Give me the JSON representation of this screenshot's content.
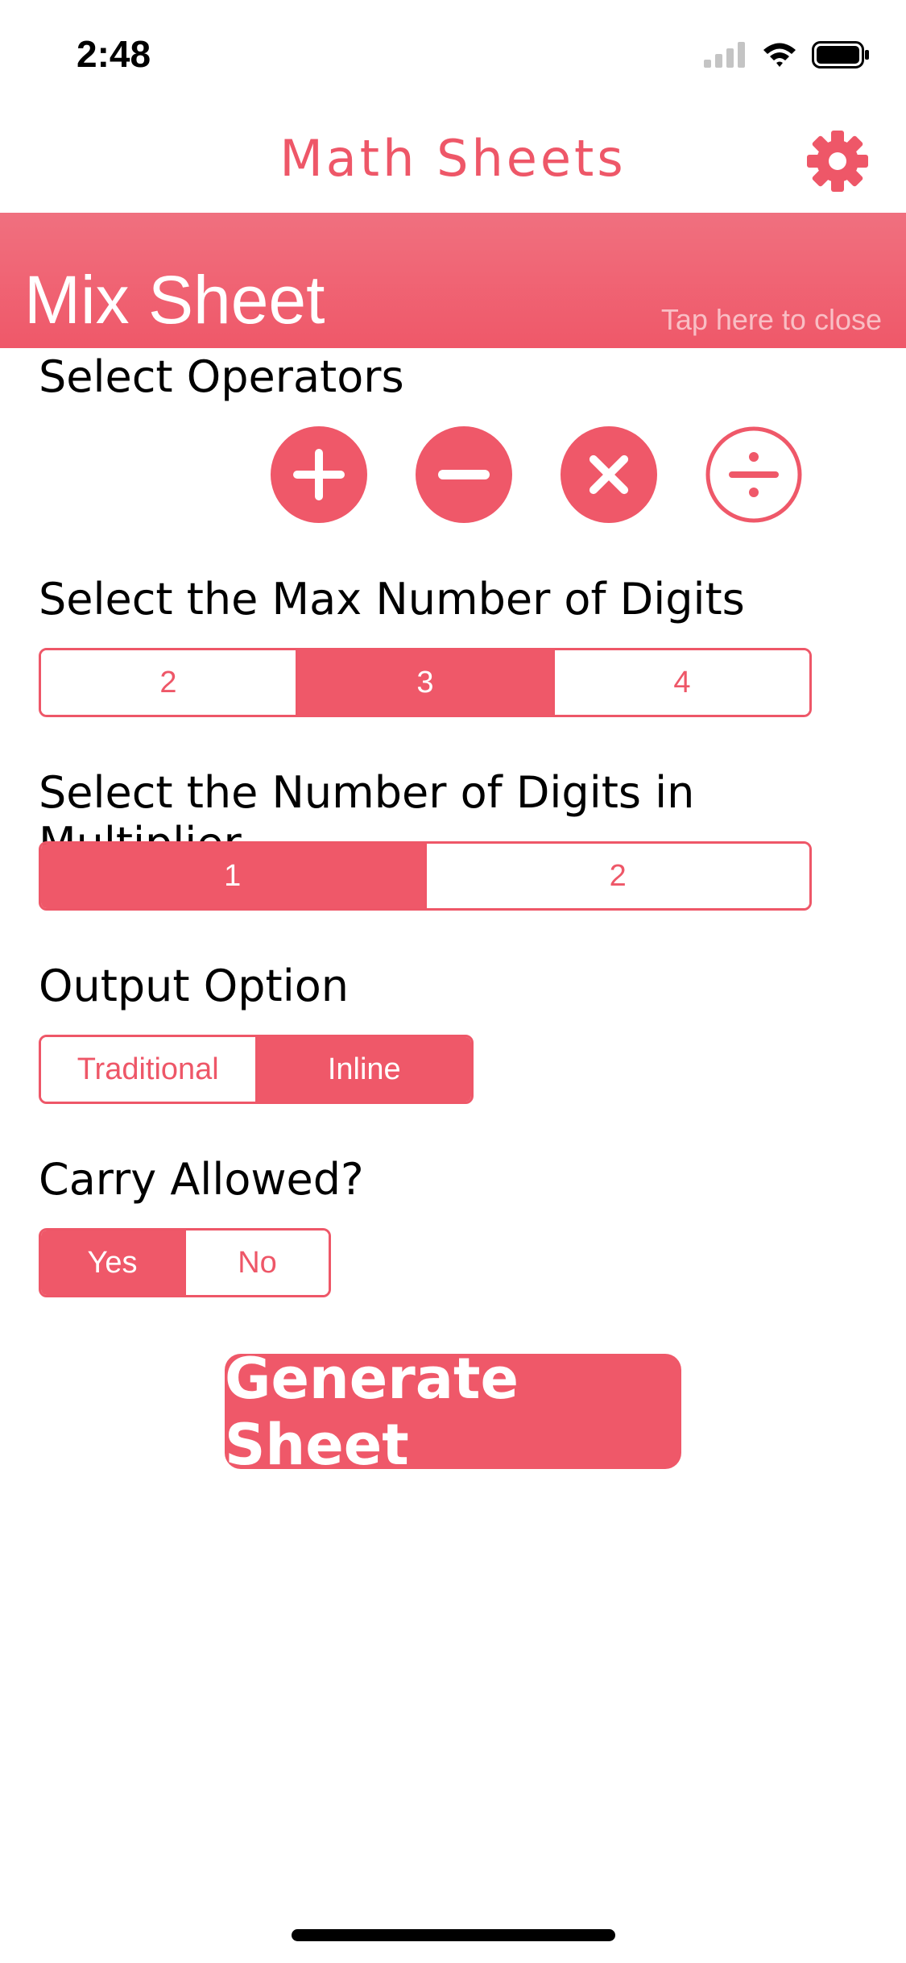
{
  "status_bar": {
    "time": "2:48",
    "icons": [
      "signal-icon",
      "wifi-icon",
      "battery-icon"
    ]
  },
  "nav": {
    "title": "Math Sheets",
    "settings_icon": "gear-icon"
  },
  "header": {
    "title": "Mix Sheet",
    "close_hint": "Tap here to close"
  },
  "operators": {
    "label": "Select Operators",
    "items": [
      {
        "name": "addition",
        "icon": "plus-icon",
        "selected": true
      },
      {
        "name": "subtraction",
        "icon": "minus-icon",
        "selected": true
      },
      {
        "name": "multiplication",
        "icon": "multiply-icon",
        "selected": true
      },
      {
        "name": "division",
        "icon": "divide-icon",
        "selected": false
      }
    ]
  },
  "max_digits": {
    "label": "Select the Max Number of Digits",
    "options": [
      "2",
      "3",
      "4"
    ],
    "selected": "3"
  },
  "multiplier_digits": {
    "label": "Select the Number of Digits in Multiplier",
    "options": [
      "1",
      "2"
    ],
    "selected": "1"
  },
  "output_option": {
    "label": "Output Option",
    "options": [
      "Traditional",
      "Inline"
    ],
    "selected": "Inline"
  },
  "carry": {
    "label": "Carry Allowed?",
    "options": [
      "Yes",
      "No"
    ],
    "selected": "Yes"
  },
  "generate_button": "Generate Sheet",
  "colors": {
    "accent": "#ef5869",
    "accent_light": "#f0707f"
  }
}
